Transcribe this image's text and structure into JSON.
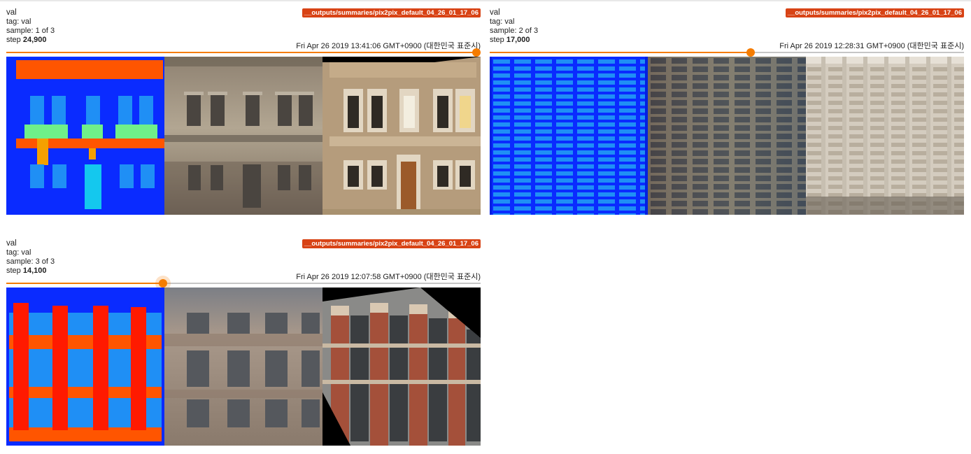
{
  "cards": [
    {
      "run": "__outputs/summaries/pix2pix_default_04_26_01_17_06",
      "title": "val",
      "tag": "tag: val",
      "sample": "sample: 1 of 3",
      "step_label": "step",
      "step_value": "24,900",
      "wall_time": "Fri Apr 26 2019 13:41:06 GMT+0900 (대한민국 표준시)",
      "slider_fraction": 1.0
    },
    {
      "run": "__outputs/summaries/pix2pix_default_04_26_01_17_06",
      "title": "val",
      "tag": "tag: val",
      "sample": "sample: 2 of 3",
      "step_label": "step",
      "step_value": "17,000",
      "wall_time": "Fri Apr 26 2019 12:28:31 GMT+0900 (대한민국 표준시)",
      "slider_fraction": 0.55
    },
    {
      "run": "__outputs/summaries/pix2pix_default_04_26_01_17_06",
      "title": "val",
      "tag": "tag: val",
      "sample": "sample: 3 of 3",
      "step_label": "step",
      "step_value": "14,100",
      "wall_time": "Fri Apr 26 2019 12:07:58 GMT+0900 (대한민국 표준시)",
      "slider_fraction": 0.33
    }
  ],
  "colors": {
    "accent": "#f57c00",
    "run_badge": "#d84315",
    "label_blue": "#0a2bff",
    "label_red": "#ff1a00",
    "label_orange": "#ff5500"
  }
}
